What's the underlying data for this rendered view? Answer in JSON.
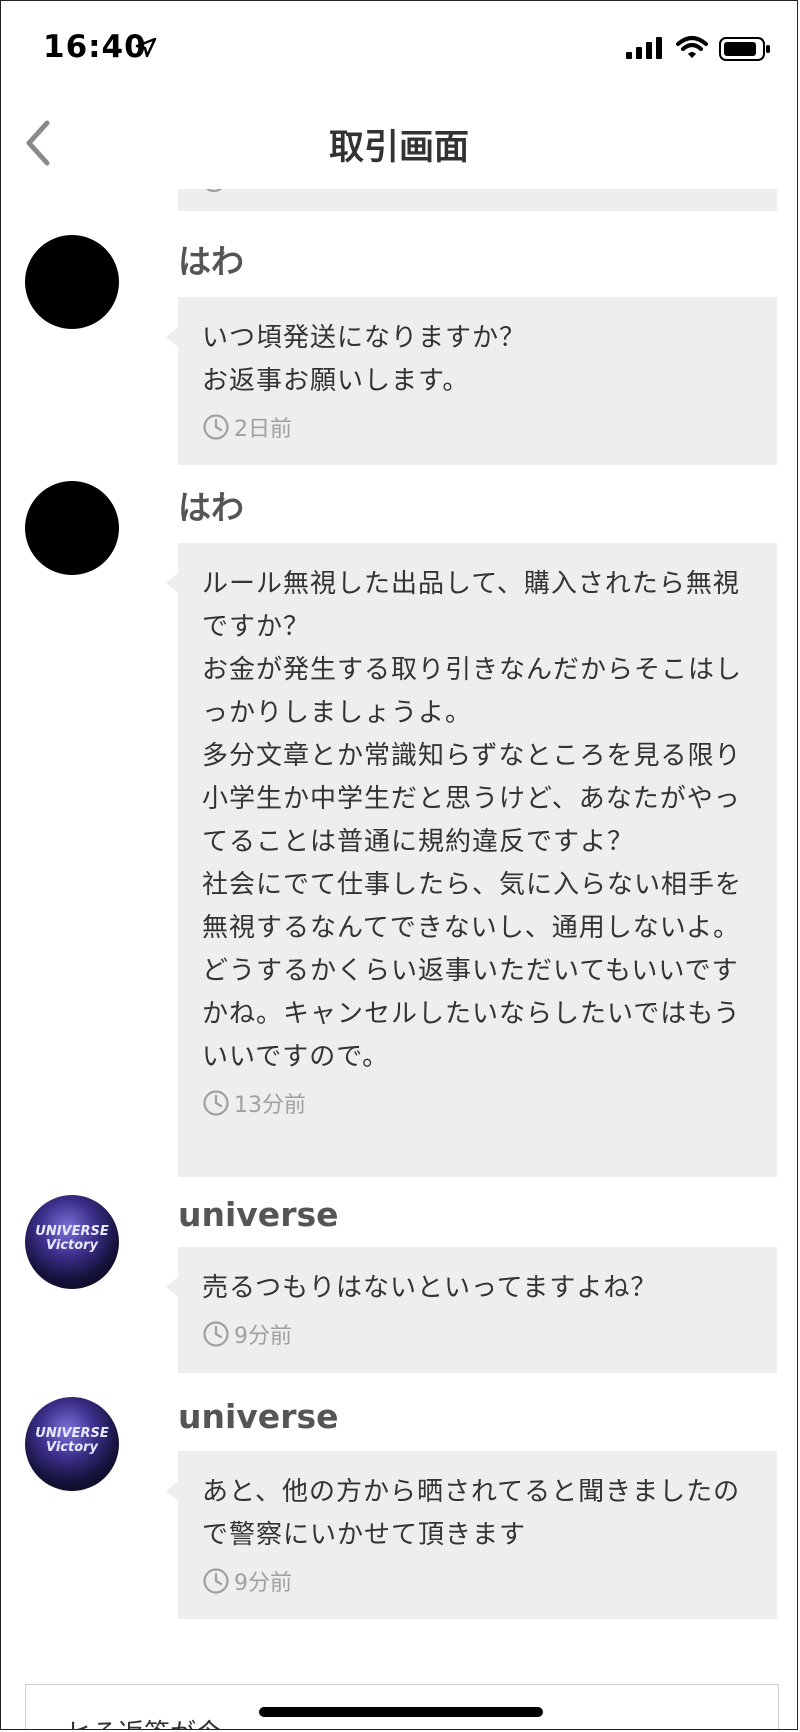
{
  "status_bar": {
    "time": "16:40",
    "icons": [
      "location-arrow-icon",
      "signal-icon",
      "wifi-icon",
      "battery-icon"
    ]
  },
  "nav": {
    "back_icon": "chevron-left-icon",
    "title": "取引画面"
  },
  "messages": [
    {
      "sender": "はわ",
      "avatar": "black-avatar",
      "text": "いつ頃発送になりますか？\nお返事お願いします。",
      "time": "2日前"
    },
    {
      "sender": "はわ",
      "avatar": "black-avatar",
      "text": "ルール無視した出品して、購入されたら無視ですか？\nお金が発生する取り引きなんだからそこはしっかりしましょうよ。\n多分文章とか常識知らずなところを見る限り小学生か中学生だと思うけど、あなたがやってることは普通に規約違反ですよ？\n社会にでて仕事したら、気に入らない相手を無視するなんてできないし、通用しないよ。\nどうするかくらい返事いただいてもいいですかね。キャンセルしたいならしたいではもういいですので。",
      "time": "13分前"
    },
    {
      "sender": "universe",
      "avatar": "universe-logo-avatar",
      "text": "売るつもりはないといってますよね？",
      "time": "9分前"
    },
    {
      "sender": "universe",
      "avatar": "universe-logo-avatar",
      "text": "あと、他の方から晒されてると聞きましたので警察にいかせて頂きます",
      "time": "9分前"
    }
  ],
  "reply": {
    "partial_text": "ヒる返答が今…"
  },
  "colors": {
    "bubble": "#eeeeee",
    "timestamp": "#a0a0a0",
    "title": "#333333"
  }
}
